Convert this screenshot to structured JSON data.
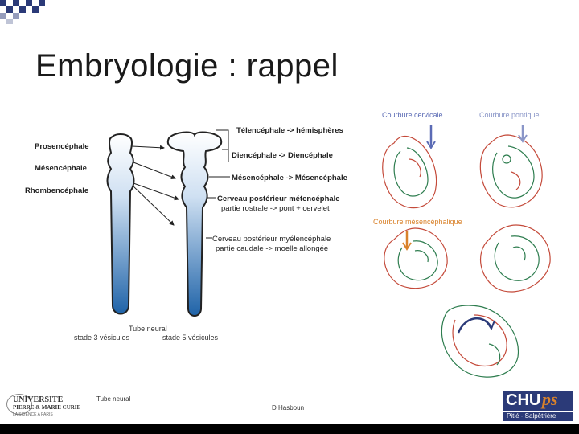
{
  "slide": {
    "title": "Embryologie : rappel",
    "author": "D Hasboun",
    "footer_left_label": "Tube neural"
  },
  "left_diagram": {
    "stage3_labels": [
      "Prosencéphale",
      "Mésencéphale",
      "Rhombencéphale"
    ],
    "stage5_labels": {
      "telencephale": "Télencéphale -> hémisphères",
      "diencephale": "Diencéphale -> Diencéphale",
      "mesencephale": "Mésencéphale -> Mésencéphale",
      "metencephale_1": "Cerveau postérieur métencéphale",
      "metencephale_2": "partie rostrale -> pont + cervelet",
      "myelencephale_1": "Cerveau postérieur myélencéphale",
      "myelencephale_2": "partie caudale -> moelle allongée"
    },
    "bottom_labels": {
      "tube": "Tube neural",
      "stage3": "stade 3 vésicules",
      "stage5": "stade 5 vésicules"
    }
  },
  "right_diagram": {
    "courbure_cervicale": "Courbure cervicale",
    "courbure_pontique": "Courbure pontique",
    "courbure_mesencephalique": "Courbure mésencéphalique"
  },
  "logos": {
    "univ_line1": "UNIVERSITE",
    "univ_line2": "PIERRE & MARIE CURIE",
    "univ_line3": "LA SCIENCE A PARIS",
    "chu_main": "CHU",
    "chu_ps": "ps",
    "chu_sub": "Pitié - Salpêtrière"
  },
  "colors": {
    "checker": "#2b3a78",
    "arrow_blue": "#5b6bb5",
    "arrow_orange": "#d9822b",
    "tube_blue": "#1f63a8",
    "embryo_red": "#c44a3a",
    "embryo_green": "#2e7d4f"
  }
}
